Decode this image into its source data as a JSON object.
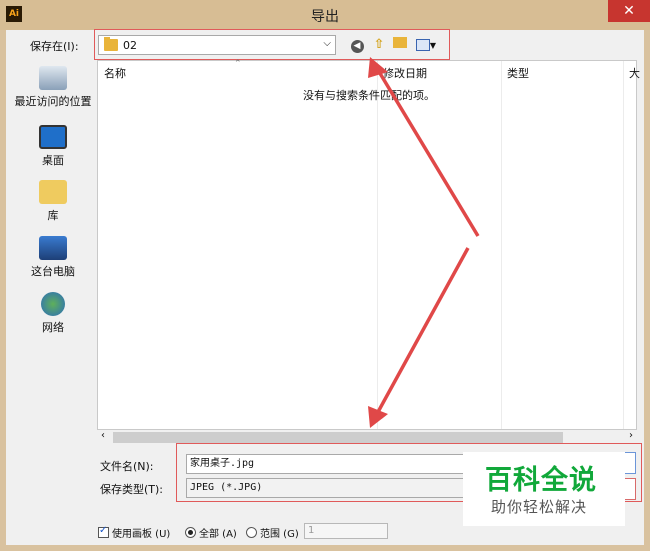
{
  "window": {
    "title": "导出",
    "app_icon": "Ai",
    "close_label": "✕"
  },
  "save_in": {
    "label": "保存在(I):",
    "value": "02"
  },
  "toolbar": {
    "icons": [
      "back-icon",
      "up-folder-icon",
      "new-folder-icon",
      "view-menu-icon"
    ]
  },
  "places": [
    {
      "label": "最近访问的位置",
      "icon": "recent-places-icon"
    },
    {
      "label": "桌面",
      "icon": "desktop-icon"
    },
    {
      "label": "库",
      "icon": "libraries-icon"
    },
    {
      "label": "这台电脑",
      "icon": "this-pc-icon"
    },
    {
      "label": "网络",
      "icon": "network-icon"
    }
  ],
  "list": {
    "columns": [
      "名称",
      "修改日期",
      "类型",
      "大"
    ],
    "empty_message": "没有与搜索条件匹配的项。"
  },
  "file_name": {
    "label": "文件名(N):",
    "value": "家用桌子.jpg"
  },
  "file_type": {
    "label": "保存类型(T):",
    "value": "JPEG (*.JPG)"
  },
  "options": {
    "use_artboards": "使用画板 (U)",
    "all": "全部 (A)",
    "range": "范围 (G)",
    "range_value": "1"
  },
  "watermark": {
    "title": "百科全说",
    "subtitle": "助你轻松解决"
  },
  "colors": {
    "annotation_red": "#e05a5a",
    "title_bar": "#d7bd94",
    "close": "#c7352f"
  }
}
